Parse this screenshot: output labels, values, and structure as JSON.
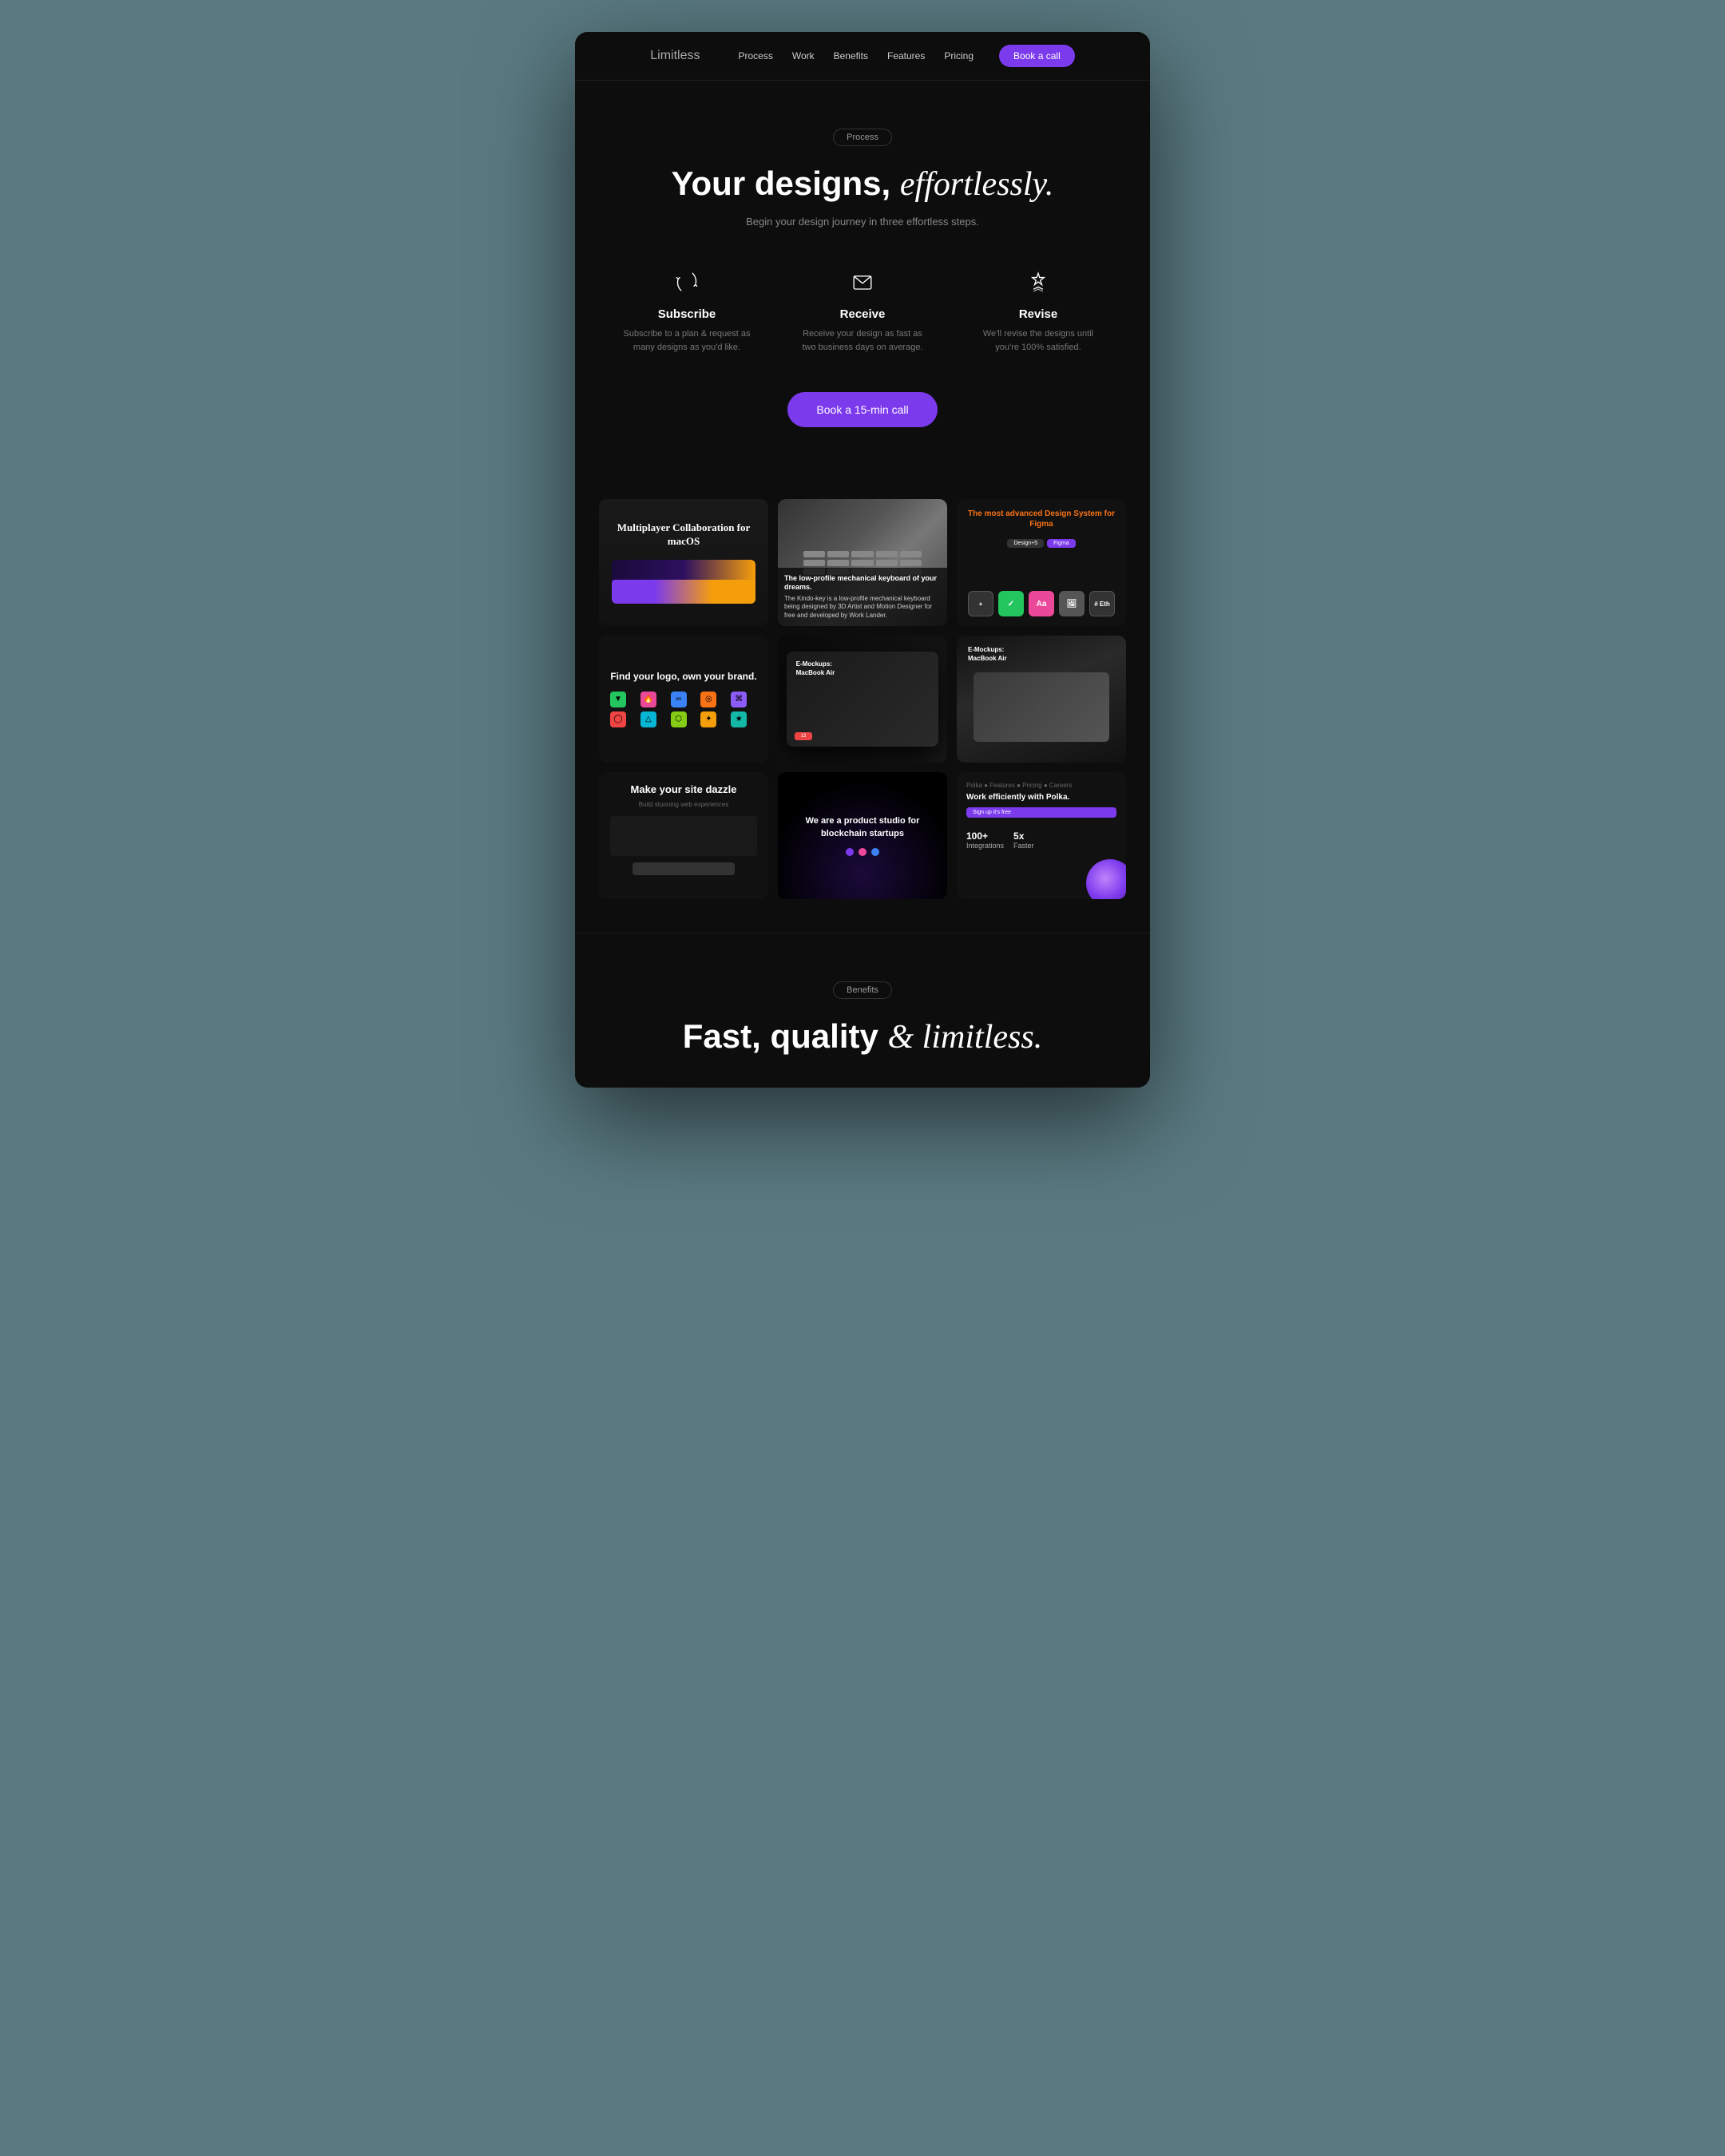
{
  "nav": {
    "logo_bold": "Limit",
    "logo_light": "less",
    "links": [
      "Process",
      "Work",
      "Benefits",
      "Features",
      "Pricing"
    ],
    "cta": "Book a call"
  },
  "hero": {
    "badge": "Process",
    "title_normal": "Your designs,",
    "title_italic": "effortlessly.",
    "subtitle": "Begin your design journey in three effortless steps.",
    "cta": "Book a 15-min call"
  },
  "steps": [
    {
      "id": "subscribe",
      "title": "Subscribe",
      "desc": "Subscribe to a plan & request as many designs as you'd like."
    },
    {
      "id": "receive",
      "title": "Receive",
      "desc": "Receive your design as fast as two business days on average."
    },
    {
      "id": "revise",
      "title": "Revise",
      "desc": "We'll revise the designs until you're 100% satisfied."
    }
  ],
  "work_cards": [
    {
      "id": "multiplayer",
      "title": "Multiplayer Collaboration for macOS"
    },
    {
      "id": "keyboard",
      "heading": "The low-profile mechanical keyboard of your dreams.",
      "desc": "The Kindo-key is a low-profile mechanical keyboard being designed by 3D Artist and Motion Designer for free and developed by Work Lander."
    },
    {
      "id": "figma",
      "title": "The most advanced Design System for",
      "title_accent": "Figma"
    },
    {
      "id": "logo",
      "title": "Find your logo, own your brand."
    },
    {
      "id": "macbook-dark",
      "title": "E-Mockups: MacBook Air"
    },
    {
      "id": "macbook-light",
      "title": "E-Mockups: MacBook Air"
    },
    {
      "id": "dazzle",
      "title": "Make your site dazzle"
    },
    {
      "id": "blockchain",
      "title": "We are a product studio for blockchain startups"
    },
    {
      "id": "polka",
      "title": "Work efficiently with Polka.",
      "stat1_label": "100+",
      "stat2_label": "5x"
    }
  ],
  "benefits": {
    "badge": "Benefits",
    "title_normal": "Fast, quality",
    "title_italic": "& limitless."
  }
}
